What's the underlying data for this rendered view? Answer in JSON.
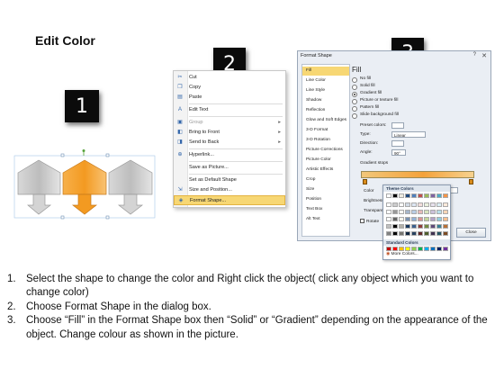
{
  "title": "Edit Color",
  "badges": [
    "1",
    "2",
    "3"
  ],
  "context_menu": {
    "items": [
      {
        "label": "Cut",
        "icon": "scissors-icon",
        "glyph": "✂"
      },
      {
        "label": "Copy",
        "icon": "copy-icon",
        "glyph": "❐"
      },
      {
        "label": "Paste",
        "icon": "paste-icon",
        "glyph": "▤"
      },
      {
        "label": "Edit Text",
        "icon": "edit-text-icon",
        "glyph": "A"
      },
      {
        "label": "Group",
        "icon": "group-icon",
        "glyph": "▣",
        "arrow": "▸",
        "disabled": true
      },
      {
        "label": "Bring to Front",
        "icon": "bring-to-front-icon",
        "glyph": "◧",
        "arrow": "▸"
      },
      {
        "label": "Send to Back",
        "icon": "send-to-back-icon",
        "glyph": "◨",
        "arrow": "▸"
      },
      {
        "label": "Hyperlink...",
        "icon": "hyperlink-icon",
        "glyph": "⊕"
      },
      {
        "label": "Save as Picture...",
        "icon": "",
        "glyph": ""
      },
      {
        "label": "Set as Default Shape",
        "icon": "",
        "glyph": ""
      },
      {
        "label": "Size and Position...",
        "icon": "size-position-icon",
        "glyph": "⇲"
      },
      {
        "label": "Format Shape...",
        "icon": "format-shape-icon",
        "glyph": "◈",
        "selected": true
      }
    ]
  },
  "format_dialog": {
    "title": "Format Shape",
    "help": "?",
    "close_glyph": "✕",
    "nav": [
      "Fill",
      "Line Color",
      "Line Style",
      "Shadow",
      "Reflection",
      "Glow and Soft Edges",
      "3-D Format",
      "3-D Rotation",
      "Picture Corrections",
      "Picture Color",
      "Artistic Effects",
      "Crop",
      "Size",
      "Position",
      "Text Box",
      "Alt Text"
    ],
    "nav_selected": "Fill",
    "heading": "Fill",
    "options": [
      {
        "label": "No fill",
        "checked": false
      },
      {
        "label": "Solid fill",
        "checked": false
      },
      {
        "label": "Gradient fill",
        "checked": true
      },
      {
        "label": "Picture or texture fill",
        "checked": false
      },
      {
        "label": "Pattern fill",
        "checked": false
      },
      {
        "label": "Slide background fill",
        "checked": false
      }
    ],
    "preset_label": "Preset colors:",
    "type_label": "Type:",
    "type_value": "Linear",
    "direction_label": "Direction:",
    "angle_label": "Angle:",
    "angle_value": "90°",
    "stops_label": "Gradient stops",
    "color_label": "Color",
    "position_label": "Position:",
    "position_value": "0%",
    "brightness_label": "Brightness",
    "transparency_label": "Transparen",
    "rotate_label": "Rotate",
    "theme_colors_label": "Theme Colors",
    "standard_colors_label": "Standard Colors",
    "more_colors_label": "More Colors...",
    "close_button": "Close",
    "theme_colors": [
      "#ffffff",
      "#000000",
      "#eeece1",
      "#1f497d",
      "#4f81bd",
      "#c0504d",
      "#9bbb59",
      "#8064a2",
      "#4bacc6",
      "#f79646"
    ],
    "standard_colors": [
      "#c00000",
      "#ff0000",
      "#ffc000",
      "#ffff00",
      "#92d050",
      "#00b050",
      "#00b0f0",
      "#0070c0",
      "#002060",
      "#7030a0"
    ],
    "gradient_colors": [
      "#f2c77a",
      "#f4a23a",
      "#f7d28f"
    ]
  },
  "shapes": {
    "colors": {
      "gray": "#c9c9c9",
      "orange": "#f5a02a"
    }
  },
  "instructions": [
    {
      "num": "1.",
      "text": "Select the shape to change the color and Right click the object( click any object which you want to change color)"
    },
    {
      "num": "2.",
      "text": "Choose Format Shape in the dialog box."
    },
    {
      "num": "3.",
      "text": "Choose “Fill” in the Format Shape box then “Solid” or “Gradient” depending on the appearance of the object. Change colour as shown in the picture."
    }
  ]
}
